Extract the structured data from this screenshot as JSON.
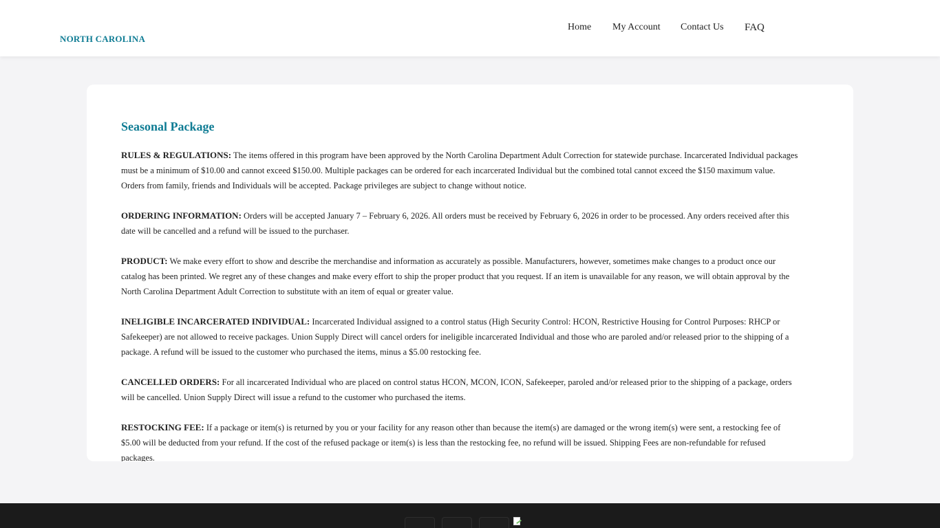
{
  "header": {
    "brand": "NORTH CAROLINA",
    "nav": [
      {
        "label": "Home"
      },
      {
        "label": "My Account"
      },
      {
        "label": "Contact Us"
      },
      {
        "label": "FAQ"
      }
    ]
  },
  "main": {
    "title": "Seasonal Package",
    "sections": [
      {
        "heading": "RULES & REGULATIONS:",
        "body": "The items offered in this program have been approved by the North Carolina Department Adult Correction for statewide purchase. Incarcerated Individual packages must be a minimum of $10.00 and cannot exceed $150.00. Multiple packages can be ordered for each incarcerated Individual but the combined total cannot exceed the $150 maximum value. Orders from family, friends and Individuals will be accepted. Package privileges are subject to change without notice."
      },
      {
        "heading": "ORDERING INFORMATION:",
        "body": "Orders will be accepted January 7 – February 6, 2026. All orders must be received by February 6, 2026 in order to be processed. Any orders received after this date will be cancelled and a refund will be issued to the purchaser."
      },
      {
        "heading": "PRODUCT:",
        "body": "We make every effort to show and describe the merchandise and information as accurately as possible. Manufacturers, however, sometimes make changes to a product once our catalog has been printed. We regret any of these changes and make every effort to ship the proper product that you request. If an item is unavailable for any reason, we will obtain approval by the North Carolina Department Adult Correction to substitute with an item of equal or greater value."
      },
      {
        "heading": "INELIGIBLE INCARCERATED INDIVIDUAL:",
        "body": "Incarcerated Individual assigned to a control status (High Security Control: HCON, Restrictive Housing for Control Purposes: RHCP or Safekeeper) are not allowed to receive packages. Union Supply Direct will cancel orders for ineligible incarcerated Individual and those who are paroled and/or released prior to the shipping of a package. A refund will be issued to the customer who purchased the items, minus a $5.00 restocking fee."
      },
      {
        "heading": "CANCELLED ORDERS:",
        "body": "For all incarcerated Individual who are placed on control status HCON, MCON, ICON, Safekeeper, paroled and/or released prior to the shipping of a package, orders will be cancelled. Union Supply Direct will issue a refund to the customer who purchased the items."
      },
      {
        "heading": "RESTOCKING FEE:",
        "body": "If a package or item(s) is returned by you or your facility for any reason other than because the item(s) are damaged or the wrong item(s) were sent, a restocking fee of $5.00 will be deducted from your refund. If the cost of the refused package or item(s) is less than the restocking fee, no refund will be issued. Shipping Fees are non-refundable for refused packages."
      }
    ]
  },
  "footer": {
    "logos": [
      "payment-logo-icon",
      "payment-logo-icon",
      "payment-logo-icon",
      "broken-image-icon"
    ]
  },
  "colors": {
    "brand": "#0f7c94",
    "page_bg": "#f4f4f6",
    "footer_bg": "#1b1b1b"
  }
}
